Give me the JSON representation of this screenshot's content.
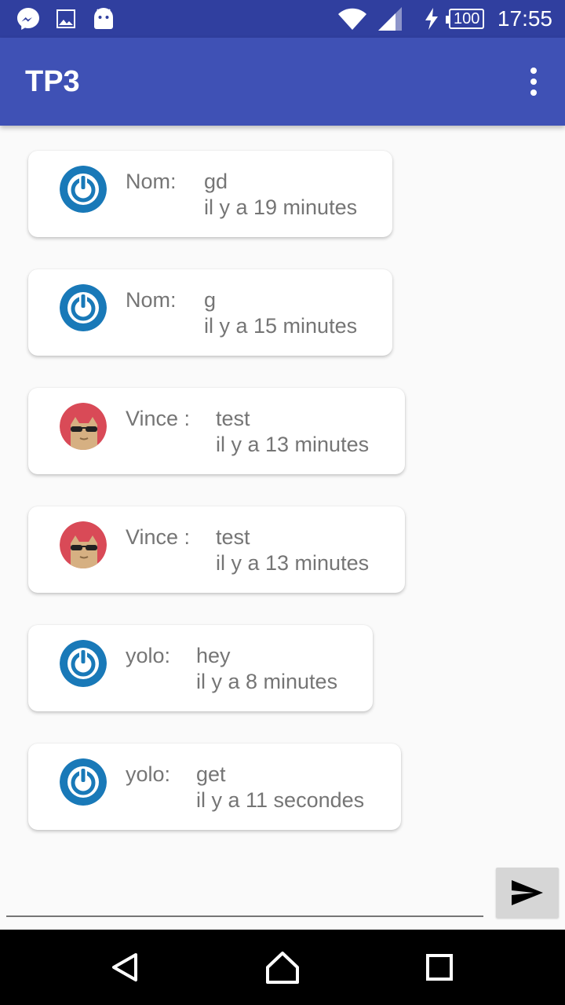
{
  "status_bar": {
    "time": "17:55",
    "battery": "100",
    "icons": [
      "messenger-icon",
      "image-icon",
      "android-icon",
      "wifi-icon",
      "signal-icon",
      "charging-icon",
      "battery-icon"
    ]
  },
  "app_bar": {
    "title": "TP3",
    "menu_icon": "more-vert-icon"
  },
  "messages": [
    {
      "sender": "Nom:",
      "text": "gd",
      "time": "il y a 19 minutes",
      "avatar": "power-icon"
    },
    {
      "sender": "Nom:",
      "text": "g",
      "time": "il y a 15 minutes",
      "avatar": "power-icon"
    },
    {
      "sender": "Vince :",
      "text": "test",
      "time": "il y a 13 minutes",
      "avatar": "cool-cat-avatar"
    },
    {
      "sender": "Vince :",
      "text": "test",
      "time": "il y a 13 minutes",
      "avatar": "cool-cat-avatar"
    },
    {
      "sender": "yolo:",
      "text": "hey",
      "time": "il y a 8 minutes",
      "avatar": "power-icon"
    },
    {
      "sender": "yolo:",
      "text": "get",
      "time": "il y a 11 secondes",
      "avatar": "power-icon"
    }
  ],
  "composer": {
    "value": "",
    "send_icon": "send-icon"
  },
  "nav_bar": {
    "icons": [
      "back-icon",
      "home-icon",
      "recents-icon"
    ]
  },
  "colors": {
    "primary": "#3f51b5",
    "primary_dark": "#303f9f",
    "power_avatar": "#1979b8",
    "cat_avatar_bg": "#d94a57",
    "text_secondary": "#757575"
  }
}
